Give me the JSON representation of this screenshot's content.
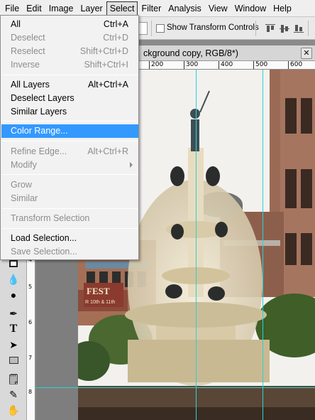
{
  "menubar": {
    "items": [
      "File",
      "Edit",
      "Image",
      "Layer",
      "Select",
      "Filter",
      "Analysis",
      "View",
      "Window",
      "Help"
    ],
    "active": "Select"
  },
  "options": {
    "show_transform_controls": "Show Transform Controls",
    "checked": false
  },
  "document": {
    "tab_title": "ckground copy, RGB/8*)"
  },
  "ruler": {
    "h_labels": [
      "200",
      "300",
      "400",
      "500",
      "600"
    ],
    "v_labels": [
      "4",
      "5",
      "6",
      "7",
      "8"
    ]
  },
  "select_menu": {
    "groups": [
      [
        {
          "label": "All",
          "shortcut": "Ctrl+A",
          "enabled": true
        },
        {
          "label": "Deselect",
          "shortcut": "Ctrl+D",
          "enabled": false
        },
        {
          "label": "Reselect",
          "shortcut": "Shift+Ctrl+D",
          "enabled": false
        },
        {
          "label": "Inverse",
          "shortcut": "Shift+Ctrl+I",
          "enabled": false
        }
      ],
      [
        {
          "label": "All Layers",
          "shortcut": "Alt+Ctrl+A",
          "enabled": true
        },
        {
          "label": "Deselect Layers",
          "shortcut": "",
          "enabled": true
        },
        {
          "label": "Similar Layers",
          "shortcut": "",
          "enabled": true
        }
      ],
      [
        {
          "label": "Color Range...",
          "shortcut": "",
          "enabled": true,
          "highlighted": true
        }
      ],
      [
        {
          "label": "Refine Edge...",
          "shortcut": "Alt+Ctrl+R",
          "enabled": false
        },
        {
          "label": "Modify",
          "shortcut": "",
          "enabled": false,
          "submenu": true
        }
      ],
      [
        {
          "label": "Grow",
          "shortcut": "",
          "enabled": false
        },
        {
          "label": "Similar",
          "shortcut": "",
          "enabled": false
        }
      ],
      [
        {
          "label": "Transform Selection",
          "shortcut": "",
          "enabled": false
        }
      ],
      [
        {
          "label": "Load Selection...",
          "shortcut": "",
          "enabled": true
        },
        {
          "label": "Save Selection...",
          "shortcut": "",
          "enabled": false
        }
      ]
    ]
  },
  "photo": {
    "banner_text": "FEST",
    "banner_sub": "R 10th & 11th"
  },
  "colors": {
    "highlight": "#3399ff",
    "guide": "#29d3d8",
    "disabled_text": "#8d8d8d"
  },
  "tools": [
    "rectangle-tool-icon",
    "blur-tool-icon",
    "dodge-tool-icon",
    "pen-tool-icon",
    "type-tool-icon",
    "path-selection-tool-icon",
    "shape-tool-icon",
    "notes-tool-icon",
    "eyedropper-tool-icon",
    "hand-tool-icon"
  ]
}
